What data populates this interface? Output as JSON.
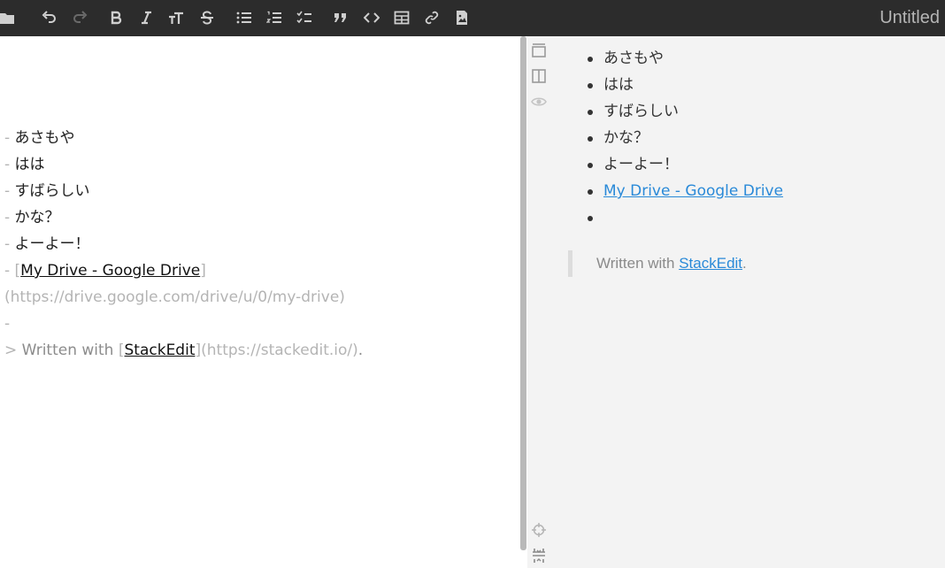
{
  "toolbar": {
    "title": "Untitled",
    "buttons": [
      {
        "name": "folder-icon"
      },
      {
        "name": "undo-icon"
      },
      {
        "name": "redo-icon"
      },
      {
        "name": "bold-icon"
      },
      {
        "name": "italic-icon"
      },
      {
        "name": "heading-icon"
      },
      {
        "name": "strikethrough-icon"
      },
      {
        "name": "bulleted-list-icon"
      },
      {
        "name": "numbered-list-icon"
      },
      {
        "name": "checklist-icon"
      },
      {
        "name": "blockquote-icon"
      },
      {
        "name": "code-icon"
      },
      {
        "name": "table-icon"
      },
      {
        "name": "link-icon"
      },
      {
        "name": "image-icon"
      }
    ]
  },
  "editor": {
    "lines": [
      {
        "marker": "- ",
        "text": "あさもや"
      },
      {
        "marker": "- ",
        "text": "はは"
      },
      {
        "marker": "- ",
        "text": "すばらしい"
      },
      {
        "marker": "- ",
        "text": "かな？"
      },
      {
        "marker": "- ",
        "text": "よーよー！"
      }
    ],
    "link_line": {
      "marker": "- [",
      "link_text": "My Drive - Google Drive",
      "close": "]",
      "url": "(https://drive.google.com/drive/u/0/my-drive)"
    },
    "empty_item": "-",
    "quote": {
      "marker": "> ",
      "text": "Written with ",
      "open": "[",
      "link_text": "StackEdit",
      "close": "]",
      "url": "(https://stackedit.io/)",
      "end": "."
    }
  },
  "preview": {
    "items": [
      "あさもや",
      "はは",
      "すばらしい",
      "かな？",
      "よーよー！"
    ],
    "link_item": "My Drive - Google Drive",
    "quote": {
      "text": "Written with ",
      "link_text": "StackEdit",
      "end": "."
    }
  },
  "side_icons": [
    "side-preview-only-icon",
    "side-split-view-icon",
    "side-eye-icon",
    "scroll-sync-icon",
    "expand-icon"
  ],
  "colors": {
    "toolbar_bg": "#2c2c2c",
    "icon": "#cfcfcf",
    "link": "#2a8ad8",
    "preview_bg": "#f3f3f3"
  }
}
